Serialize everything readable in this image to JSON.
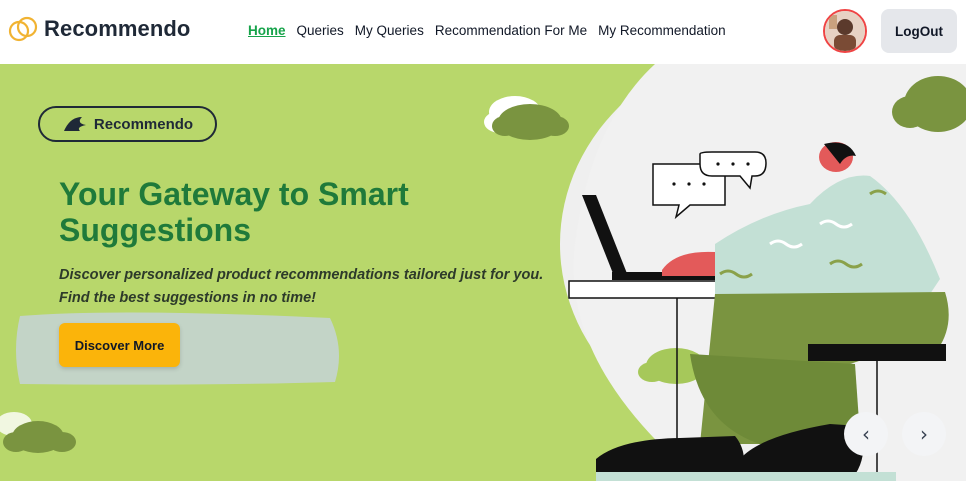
{
  "brand": {
    "name": "Recommendo"
  },
  "nav": {
    "links": [
      {
        "label": "Home"
      },
      {
        "label": "Queries"
      },
      {
        "label": "My Queries"
      },
      {
        "label": "Recommendation For Me"
      },
      {
        "label": "My Recommendation"
      }
    ],
    "logout_label": "LogOut"
  },
  "hero": {
    "badge_text": "Recommendo",
    "title": "Your Gateway to Smart Suggestions",
    "subtitle_line1": "Discover personalized product recommendations tailored just for you.",
    "subtitle_line2": "Find the best suggestions in no time!",
    "cta_label": "Discover More",
    "prev_label": "‹",
    "next_label": "›"
  },
  "colors": {
    "accent_green": "#16a34a",
    "title_green": "#1f7a3a",
    "hero_bg": "#b3d36a",
    "cta": "#fbb40a"
  },
  "icons": [
    "logo-rings-icon",
    "leaf-logo-icon",
    "avatar-icon",
    "chevron-left-icon",
    "chevron-right-icon"
  ]
}
